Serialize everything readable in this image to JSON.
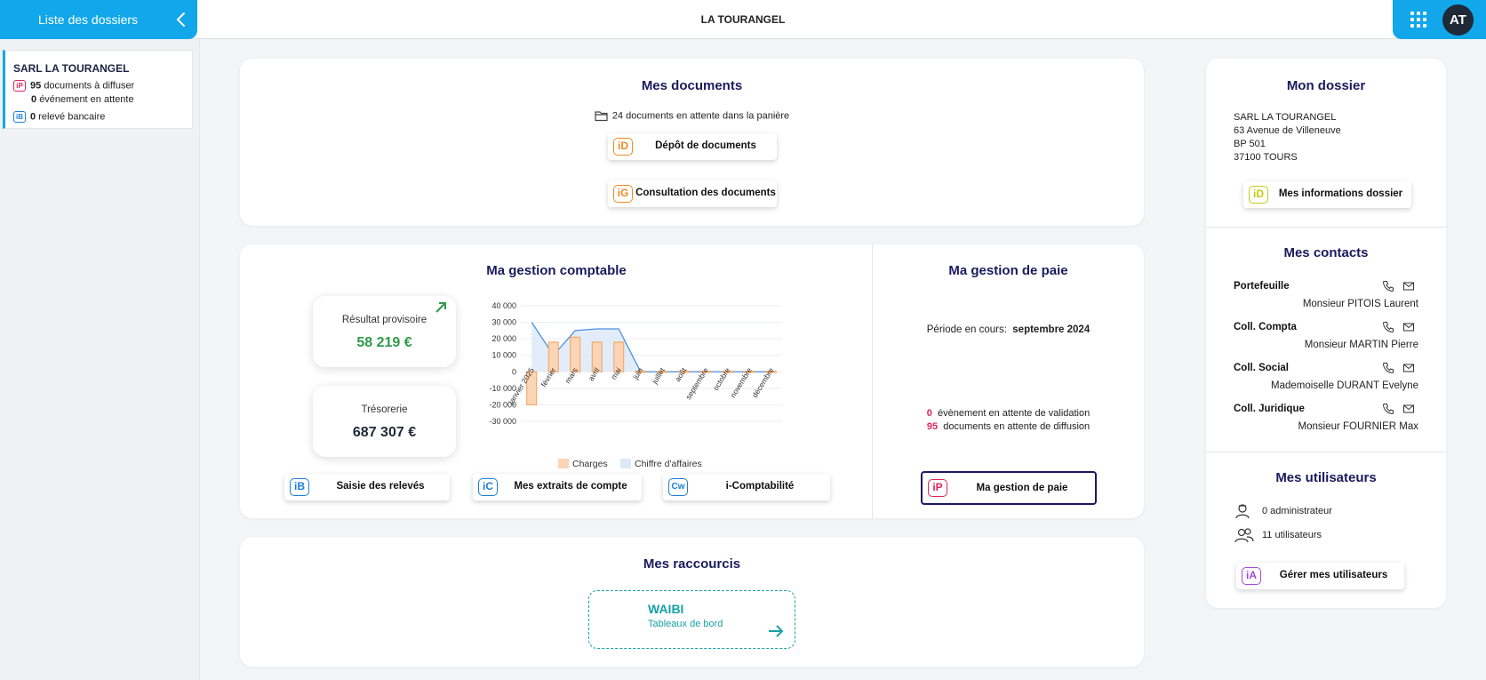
{
  "topbar": {
    "sidebar_toggle_label": "Liste des dossiers",
    "title": "LA TOURANGEL",
    "avatar_initials": "AT"
  },
  "sidebar": {
    "dossier_name": "SARL LA TOURANGEL",
    "docs_badge": "iP",
    "docs_count": "95",
    "docs_text": "documents à diffuser",
    "events_count": "0",
    "events_text": "événement en attente",
    "bank_badge": "iB",
    "bank_count": "0",
    "bank_text": "relevé bancaire"
  },
  "documents": {
    "title": "Mes documents",
    "pending_text": "24 documents en attente dans la panière",
    "depot_icon": "iD",
    "depot_label": "Dépôt de documents",
    "consult_icon": "iG",
    "consult_label": "Consultation des documents"
  },
  "comptable": {
    "title": "Ma gestion comptable",
    "resultat_label": "Résultat provisoire",
    "resultat_value": "58 219 €",
    "tresorerie_label": "Trésorerie",
    "tresorerie_value": "687 307 €",
    "btn1_icon": "iB",
    "btn1_label": "Saisie des relevés",
    "btn2_icon": "iC",
    "btn2_label": "Mes extraits de compte",
    "btn3_icon": "Cw",
    "btn3_label": "i-Comptabilité"
  },
  "chart_data": {
    "type": "bar",
    "categories": [
      "janvier 2025",
      "février",
      "mars",
      "avril",
      "mai",
      "juin",
      "juillet",
      "août",
      "septembre",
      "octobre",
      "novembre",
      "décembre"
    ],
    "series": [
      {
        "name": "Charges",
        "type": "bar",
        "values": [
          -20000,
          18000,
          21000,
          18000,
          18000,
          0,
          0,
          0,
          0,
          0,
          0,
          0
        ]
      },
      {
        "name": "Chiffre d'affaires",
        "type": "area",
        "values": [
          30000,
          10000,
          25000,
          26000,
          26000,
          0,
          0,
          0,
          0,
          0,
          0,
          0
        ]
      }
    ],
    "ylim": [
      -30000,
      40000
    ],
    "yticks": [
      "40 000",
      "30 000",
      "20 000",
      "10 000",
      "0",
      "-10 000",
      "-20 000",
      "-30 000"
    ],
    "ytick_values": [
      40000,
      30000,
      20000,
      10000,
      0,
      -10000,
      -20000,
      -30000
    ],
    "grid": true,
    "legend": "bottom",
    "colors": {
      "charges": "#fbd5b5",
      "charges_stroke": "#f3a25d",
      "ca_fill": "#dce8f8",
      "ca_line": "#4a90e2"
    }
  },
  "paie": {
    "title": "Ma gestion de paie",
    "period_label": "Période en cours:",
    "period_value": "septembre 2024",
    "events_count": "0",
    "events_text": "évènement en attente de validation",
    "docs_count": "95",
    "docs_text": "documents en attente de diffusion",
    "btn_icon": "iP",
    "btn_label": "Ma gestion de paie"
  },
  "raccourcis": {
    "title": "Mes raccourcis",
    "shortcut_title": "WAIBI",
    "shortcut_subtitle": "Tableaux de bord"
  },
  "dossier": {
    "title": "Mon dossier",
    "address": [
      "SARL LA TOURANGEL",
      "63 Avenue de Villeneuve",
      "BP 501",
      "37100 TOURS"
    ],
    "btn_icon": "iD",
    "btn_label": "Mes informations dossier"
  },
  "contacts": {
    "title": "Mes contacts",
    "items": [
      {
        "role": "Portefeuille",
        "name": "Monsieur PITOIS Laurent"
      },
      {
        "role": "Coll. Compta",
        "name": "Monsieur MARTIN Pierre"
      },
      {
        "role": "Coll. Social",
        "name": "Mademoiselle DURANT Evelyne"
      },
      {
        "role": "Coll. Juridique",
        "name": "Monsieur FOURNIER Max"
      }
    ]
  },
  "utilisateurs": {
    "title": "Mes utilisateurs",
    "admins": "0 administrateur",
    "users": "11 utilisateurs",
    "btn_icon": "iA",
    "btn_label": "Gérer mes utilisateurs"
  },
  "colors": {
    "accent": "#11a7ea",
    "title": "#1a1b5e",
    "positive": "#2e9a4a",
    "alert": "#e0245e",
    "teal": "#16a0a6"
  }
}
